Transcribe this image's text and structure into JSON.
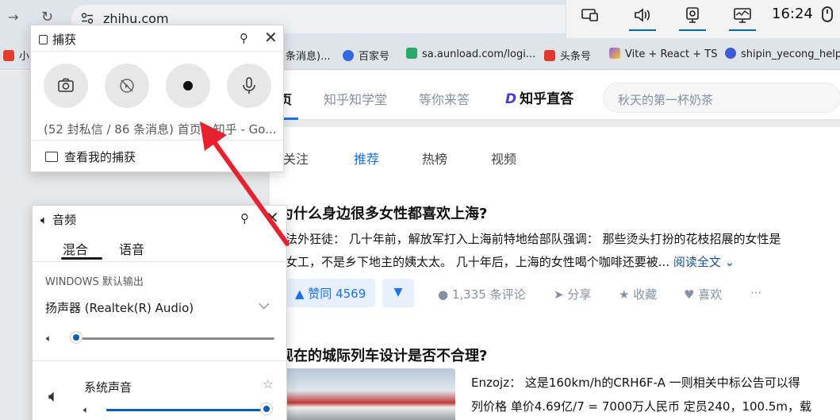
{
  "browser": {
    "url": "zhihu.com",
    "bookmarks": [
      {
        "label": "小",
        "color": "#e33b2e"
      },
      {
        "label": "条消息)...",
        "color": "#ffffff"
      },
      {
        "label": "百家号",
        "color": "#2f6be0"
      },
      {
        "label": "sa.aunload.com/logi...",
        "color": "#2aa86a"
      },
      {
        "label": "头条号",
        "color": "#e4382d"
      },
      {
        "label": "Vite + React + TS",
        "color": "#8f5cf7"
      },
      {
        "label": "shipin_yecong_help...",
        "color": "#3b5bdb"
      }
    ]
  },
  "taskbar": {
    "time": "16:24",
    "icons": [
      "display-icon",
      "volume-icon",
      "capture-icon",
      "performance-icon",
      "mouse-icon"
    ]
  },
  "zhihu": {
    "nav": [
      "页",
      "知乎知学堂",
      "等你来答"
    ],
    "logo": "知乎直答",
    "logo_mark": "D",
    "search_placeholder": "秋天的第一杯奶茶",
    "feed_tabs": [
      "关注",
      "推荐",
      "热榜",
      "视频"
    ],
    "posts": [
      {
        "title": "为什么身边很多女性都喜欢上海?",
        "excerpt1": "法外狂徒： 几十年前，解放军打入上海前特地给部队强调： 那些烫头打扮的花枝招展的女性是",
        "excerpt2": "女工，不是乡下地主的姨太太。 几十年后，上海的女性喝个咖啡还要被...",
        "read_more": "阅读全文 ⌄",
        "upvote": "▲ 赞同 4569",
        "downvote": "▼",
        "comments": "1,335 条评论",
        "share": "分享",
        "collect": "收藏",
        "like": "喜欢",
        "more": "···"
      },
      {
        "title": "现在的城际列车设计是否不合理?",
        "excerpt1": "Enzojz： 这是160km/h的CRH6F-A 一则相关中标公告可以得",
        "excerpt2": "列价格 单价4.69亿/7 = 7000万人民币 定员240，100.5m，载"
      }
    ]
  },
  "capture_panel": {
    "title": "捕获",
    "buttons": [
      "screenshot-button",
      "replay-button",
      "record-button",
      "mic-button"
    ],
    "source": "(52 封私信 / 86 条消息) 首页 - 知乎 - Go...",
    "view_captures": "查看我的捕获"
  },
  "audio_panel": {
    "title": "音频",
    "tabs": [
      "混合",
      "语音"
    ],
    "output_caption": "WINDOWS 默认输出",
    "device": "扬声器 (Realtek(R) Audio)",
    "master_volume": 0,
    "system_sound_label": "系统声音",
    "system_volume": 1.0
  }
}
